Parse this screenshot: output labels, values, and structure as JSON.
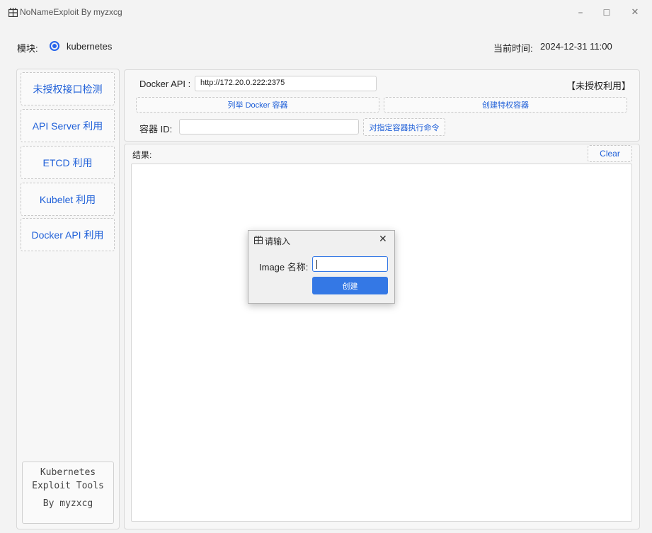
{
  "window": {
    "title": "NoNameExploit By myzxcg",
    "minimize": "–",
    "maximize": "☐",
    "close": "✕"
  },
  "module": {
    "label": "模块:",
    "selected": "kubernetes"
  },
  "clock": {
    "label": "当前时间:",
    "value": "2024-12-31 11:00"
  },
  "sidebar": {
    "items": [
      {
        "label": "未授权接口检测"
      },
      {
        "label": "API Server 利用"
      },
      {
        "label": "ETCD 利用"
      },
      {
        "label": "Kubelet 利用"
      },
      {
        "label": "Docker API 利用"
      }
    ],
    "credit": {
      "line1": "Kubernetes",
      "line2": "Exploit Tools",
      "line3": "By myzxcg"
    }
  },
  "docker": {
    "api_label": "Docker API :",
    "api_value": "http://172.20.0.222:2375",
    "badge": "【未授权利用】",
    "list_button": "列举 Docker 容器",
    "create_button": "创建特权容器",
    "container_label": "容器 ID:",
    "container_value": "",
    "exec_button": "对指定容器执行命令"
  },
  "results": {
    "label": "结果:",
    "clear_button": "Clear"
  },
  "dialog": {
    "title": "请输入",
    "close": "✕",
    "field_label": "Image 名称:",
    "field_value": "",
    "submit": "创建"
  },
  "colors": {
    "accent": "#1e5fd8",
    "primary_button": "#3478e5",
    "radio": "#2563eb"
  }
}
